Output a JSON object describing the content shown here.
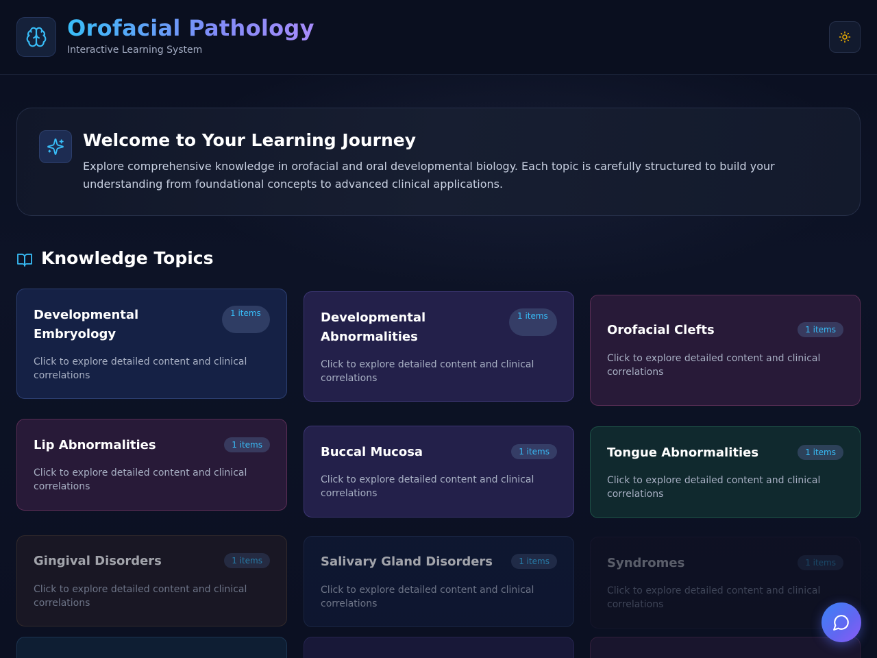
{
  "header": {
    "title": "Orofacial Pathology",
    "subtitle": "Interactive Learning System",
    "logo_icon": "brain-icon",
    "theme_icon": "sun-icon"
  },
  "welcome": {
    "title": "Welcome to Your Learning Journey",
    "text": "Explore comprehensive knowledge in orofacial and oral developmental biology. Each topic is carefully structured to build your understanding from foundational concepts to advanced clinical applications.",
    "icon": "sparkles-icon"
  },
  "section": {
    "title": "Knowledge Topics",
    "icon": "book-open-icon"
  },
  "topics": [
    {
      "title": "Developmental Embryology",
      "badge": "1 items",
      "desc": "Click to explore detailed content and clinical correlations"
    },
    {
      "title": "Developmental Abnormalities",
      "badge": "1 items",
      "desc": "Click to explore detailed content and clinical correlations"
    },
    {
      "title": "Orofacial Clefts",
      "badge": "1 items",
      "desc": "Click to explore detailed content and clinical correlations"
    },
    {
      "title": "Lip Abnormalities",
      "badge": "1 items",
      "desc": "Click to explore detailed content and clinical correlations"
    },
    {
      "title": "Buccal Mucosa",
      "badge": "1 items",
      "desc": "Click to explore detailed content and clinical correlations"
    },
    {
      "title": "Tongue Abnormalities",
      "badge": "1 items",
      "desc": "Click to explore detailed content and clinical correlations"
    },
    {
      "title": "Gingival Disorders",
      "badge": "1 items",
      "desc": "Click to explore detailed content and clinical correlations"
    },
    {
      "title": "Salivary Gland Disorders",
      "badge": "1 items",
      "desc": "Click to explore detailed content and clinical correlations"
    },
    {
      "title": "Syndromes",
      "badge": "1 items",
      "desc": "Click to explore detailed content and clinical correlations"
    }
  ],
  "chat": {
    "icon": "chat-bubble-icon"
  },
  "colors": {
    "accent": "#38bdf8",
    "title_gradient_start": "#38bdf8",
    "title_gradient_end": "#a78bfa",
    "chat_button": "#6366f1"
  }
}
